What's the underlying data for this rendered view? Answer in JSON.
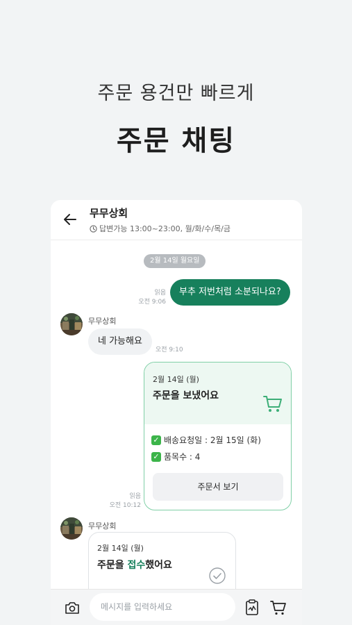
{
  "promo": {
    "subtitle": "주문 용건만 빠르게",
    "title": "주문 채팅"
  },
  "header": {
    "shop_name": "무무상회",
    "hours": "답변가능 13:00~23:00, 월/화/수/목/금"
  },
  "date_divider": "2월 14일 월요일",
  "messages": {
    "outgoing": {
      "text": "부추 저번처럼 소분되나요?",
      "read": "읽음",
      "time": "오전 9:06"
    },
    "incoming": {
      "sender": "무무상회",
      "text": "네 가능해요",
      "time": "오전 9:10"
    }
  },
  "order_card": {
    "date": "2월 14일 (월)",
    "title": "주문을 보냈어요",
    "delivery_date": "배송요청일 : 2월 15일 (화)",
    "item_count": "품목수 : 4",
    "button": "주문서 보기",
    "read": "읽음",
    "time": "오전 10:12"
  },
  "received_card": {
    "sender": "무무상회",
    "date": "2월 14일 (월)",
    "title_pre": "주문을 ",
    "title_highlight": "접수",
    "title_post": "했어요"
  },
  "input": {
    "placeholder": "메시지를 입력하세요"
  },
  "colors": {
    "accent": "#17805c",
    "card_border": "#7fcfa6",
    "card_top": "#edf8f2",
    "background": "#f2f4f5"
  },
  "icons": [
    "back-arrow-icon",
    "clock-icon",
    "cart-icon",
    "check-icon",
    "check-circle-icon",
    "camera-icon",
    "clipboard-icon"
  ]
}
